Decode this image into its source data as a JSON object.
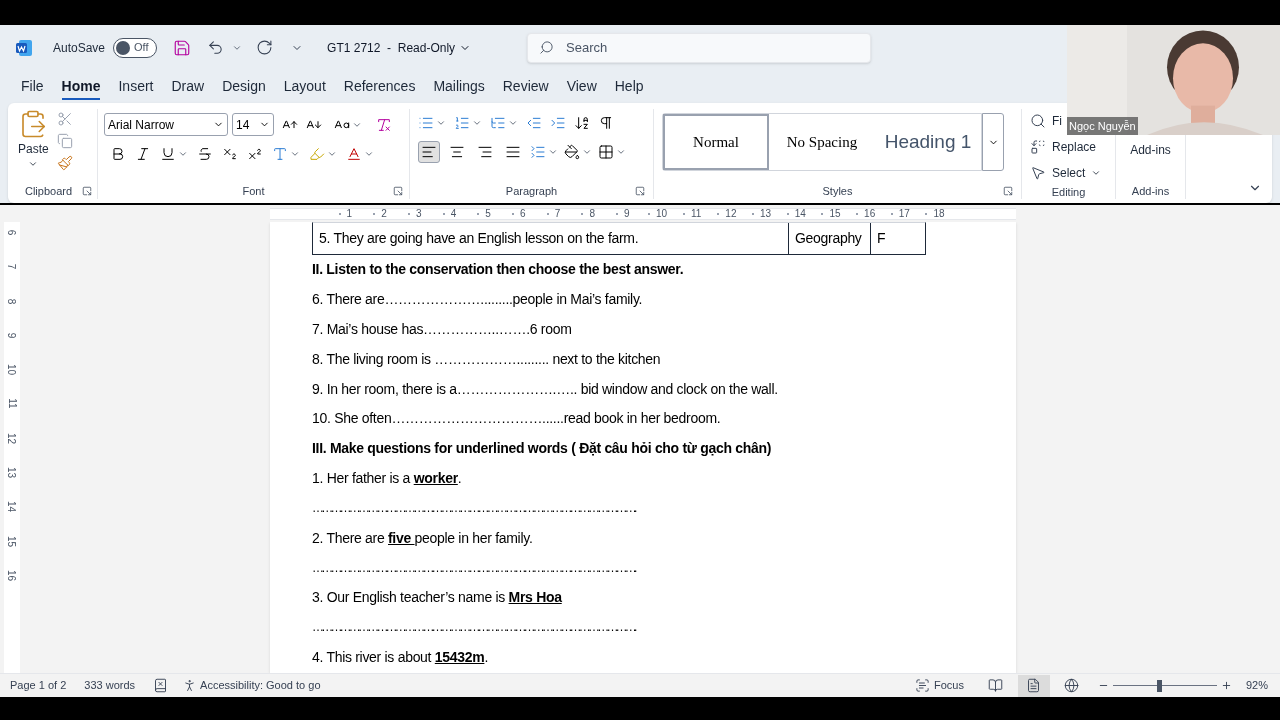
{
  "title_bar": {
    "autosave_label": "AutoSave",
    "autosave": {
      "on": false,
      "label": "Off"
    },
    "document_title": "GT1 2712  -  Read-Only",
    "search": {
      "placeholder": "Search"
    }
  },
  "tabs": [
    {
      "label": "File",
      "selected": false
    },
    {
      "label": "Home",
      "selected": true
    },
    {
      "label": "Insert",
      "selected": false
    },
    {
      "label": "Draw",
      "selected": false
    },
    {
      "label": "Design",
      "selected": false
    },
    {
      "label": "Layout",
      "selected": false
    },
    {
      "label": "References",
      "selected": false
    },
    {
      "label": "Mailings",
      "selected": false
    },
    {
      "label": "Review",
      "selected": false
    },
    {
      "label": "View",
      "selected": false
    },
    {
      "label": "Help",
      "selected": false
    }
  ],
  "ribbon": {
    "clipboard": {
      "paste": "Paste",
      "label": "Clipboard"
    },
    "font": {
      "font_name": "Arial Narrow",
      "font_size": "14",
      "label": "Font"
    },
    "paragraph": {
      "label": "Paragraph",
      "alignments": [
        {
          "kind": "left",
          "selected": true
        },
        {
          "kind": "center",
          "selected": false
        },
        {
          "kind": "right",
          "selected": false
        },
        {
          "kind": "justify",
          "selected": false
        }
      ]
    },
    "styles": {
      "label": "Styles",
      "items": [
        {
          "label": "Normal",
          "kind": "normal",
          "selected": true
        },
        {
          "label": "No Spacing",
          "kind": "no_spacing",
          "selected": false
        },
        {
          "label": "Heading 1",
          "kind": "heading",
          "selected": false
        }
      ]
    },
    "editing": {
      "label": "Editing",
      "items": [
        {
          "label": "Fi",
          "kind": "find"
        },
        {
          "label": "Replace",
          "kind": "replace"
        },
        {
          "label": "Select",
          "kind": "select"
        }
      ]
    },
    "addins": {
      "button": "Add-ins",
      "label": "Add-ins"
    }
  },
  "ruler": {
    "marks": [
      "1",
      "2",
      "3",
      "4",
      "5",
      "6",
      "7",
      "8",
      "9",
      "10",
      "11",
      "12",
      "13",
      "14",
      "15",
      "16",
      "17",
      "18"
    ]
  },
  "vertical_ruler": {
    "marks": [
      "6",
      "7",
      "8",
      "9",
      "10",
      "11",
      "12",
      "13",
      "14",
      "15",
      "16"
    ]
  },
  "document": {
    "table_row": [
      "5. They are going have an English lesson on the farm.",
      "Geography",
      "F"
    ],
    "lines": [
      {
        "kind": "heading",
        "text": "II. Listen to the conservation then choose the best answer."
      },
      {
        "kind": "text",
        "text": "6. There are………………….........people in Mai’s family."
      },
      {
        "kind": "text",
        "text": "7. Mai’s house has……………..…….6 room"
      },
      {
        "kind": "text",
        "text": "8. The living room is ………………......... next to the kitchen"
      },
      {
        "kind": "text",
        "text": "9. In her room, there is a………………….….. bid window and clock on the wall."
      },
      {
        "kind": "text",
        "text": "10. She often……………………………......read book in her bedroom."
      },
      {
        "kind": "heading",
        "text": "III. Make questions for underlined words ( Đặt câu hỏi cho từ gạch chân)"
      },
      {
        "kind": "question",
        "before": "1. Her father is a ",
        "answer": "worker",
        "after": "."
      },
      {
        "kind": "dots",
        "text": "……………………………………………………………………………………………."
      },
      {
        "kind": "question",
        "before": "2. There are ",
        "answer": "five ",
        "after": "people in her family."
      },
      {
        "kind": "dots",
        "text": "……………………………………………………………………………………………."
      },
      {
        "kind": "question",
        "before": "3. Our English teacher’s name is ",
        "answer": "Mrs Hoa"
      },
      {
        "kind": "dots",
        "text": "……………………………………………………………………………………………."
      },
      {
        "kind": "question",
        "before": "4. This river is about ",
        "answer": "15432m",
        "after": "."
      }
    ]
  },
  "status_bar": {
    "page": "Page 1 of 2",
    "words": "333 words",
    "accessibility": "Accessibility: Good to go",
    "focus": "Focus",
    "views": [
      {
        "kind": "read",
        "selected": false
      },
      {
        "kind": "print",
        "selected": true
      },
      {
        "kind": "web",
        "selected": false
      }
    ],
    "zoom": {
      "level": 0.42,
      "reading": "92%"
    }
  },
  "webcam": {
    "kind": "picture",
    "name": "Ngọc Nguyễn"
  }
}
